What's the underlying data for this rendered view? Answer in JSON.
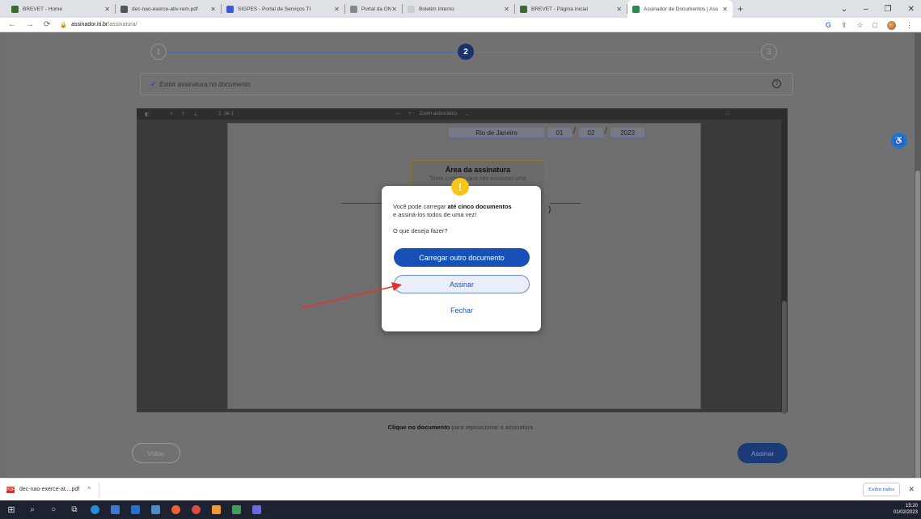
{
  "browser": {
    "tabs": [
      {
        "title": "BREVET - Home",
        "favicon_color": "#3a6b2f",
        "active": false
      },
      {
        "title": "dec-nao-exerce-ativ-rem.pdf",
        "favicon_color": "#555555",
        "active": false
      },
      {
        "title": "SIGPES - Portal de Serviços TI",
        "favicon_color": "#3b5bd6",
        "active": false
      },
      {
        "title": "Portal da OM",
        "favicon_color": "#888888",
        "active": false
      },
      {
        "title": "Boletim Interno",
        "favicon_color": "#cccccc",
        "active": false
      },
      {
        "title": "BREVET - Página inicial",
        "favicon_color": "#3a6b2f",
        "active": false
      },
      {
        "title": "Assinador de Documentos | Ass",
        "favicon_color": "#2a8a4a",
        "active": true
      }
    ],
    "url_host": "assinador.iti.br",
    "url_path": "/assinatura/"
  },
  "stepper": {
    "steps": [
      "1",
      "2",
      "3"
    ],
    "active_index": 1
  },
  "signature_option": {
    "label": "Exibir assinatura no documento",
    "checked": true
  },
  "viewer": {
    "page_indicator": "1",
    "page_total": "de 1",
    "zoom_label": "Zoom automático",
    "date_city": "Rio de Janeiro",
    "date_day": "01",
    "date_month": "02",
    "date_year": "2023",
    "sig_area_title": "Área da assinatura",
    "sig_area_text": "Tome cuidado para não esconder uma",
    "paren_text": ")"
  },
  "hint": {
    "bold": "Clique no documento",
    "rest": " para reposicionar a assinatura"
  },
  "buttons": {
    "back": "Voltar",
    "sign": "Assinar"
  },
  "modal": {
    "text_prefix": "Você pode carregar ",
    "text_bold": "até cinco documentos",
    "text_suffix": "e assiná-los todos de uma vez!",
    "question": "O que deseja fazer?",
    "load_another": "Carregar outro documento",
    "sign": "Assinar",
    "close": "Fechar"
  },
  "downloads": {
    "filename": "dec-nao-exerce-at....pdf",
    "show_all": "Exibir todos"
  },
  "clock": {
    "time": "15:20",
    "date": "01/02/2023"
  }
}
